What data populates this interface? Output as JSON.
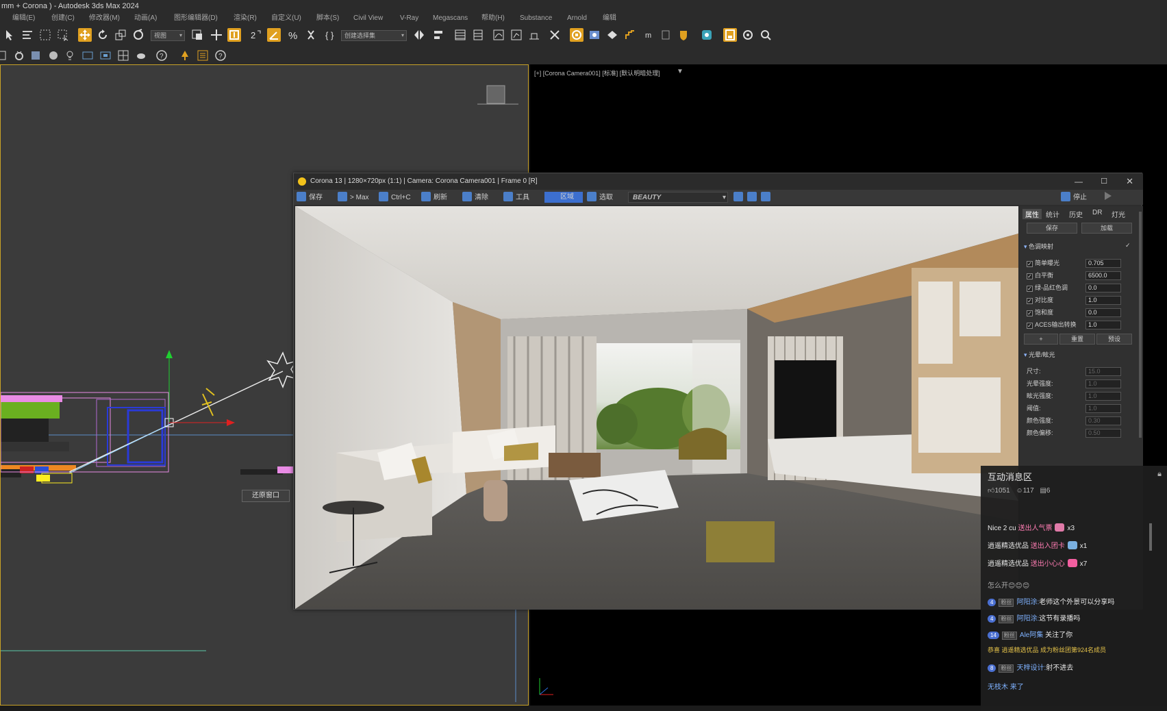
{
  "window": {
    "title": "mm + Corona ) - Autodesk 3ds Max 2024"
  },
  "menu": {
    "items": [
      "编辑(E)",
      "创建(C)",
      "修改器(M)",
      "动画(A)",
      "图形编辑器(D)",
      "渲染(R)",
      "自定义(U)",
      "脚本(S)",
      "Civil View",
      "V-Ray",
      "Megascans",
      "帮助(H)",
      "Substance",
      "Arnold",
      "编辑"
    ]
  },
  "toolbar": {
    "view_dropdown": "视图",
    "selection_set_dropdown": "创建选择集"
  },
  "viewport_right": {
    "label": "[+] [Corona Camera001] [标准] [默认明暗处理]"
  },
  "viewport_left": {
    "restore_button": "还原窗口"
  },
  "vfb": {
    "title": "Corona 13 | 1280×720px (1:1) | Camera: Corona Camera001 | Frame 0 [R]",
    "toolbar": {
      "save": "保存",
      "to_max": "> Max",
      "copy": "Ctrl+C",
      "refresh": "刷新",
      "clear": "清除",
      "tools": "工具",
      "region": "区域",
      "pick": "选取",
      "pass": "BEAUTY",
      "stop": "停止"
    },
    "colors": {
      "accent": "#4b7fc9",
      "active_button": "#3c6fcf"
    },
    "props": {
      "tabs": [
        "属性",
        "统计",
        "历史",
        "DR",
        "灯光"
      ],
      "save_button": "保存",
      "load_button": "加载",
      "section_tone": "色调映射",
      "rows": [
        {
          "label": "简单曝光",
          "value": "0.705"
        },
        {
          "label": "白平衡",
          "value": "6500.0"
        },
        {
          "label": "绿-品红色调",
          "value": "0.0"
        },
        {
          "label": "对比度",
          "value": "1.0"
        },
        {
          "label": "饱和度",
          "value": "0.0"
        },
        {
          "label": "ACES输出转换",
          "value": "1.0"
        }
      ],
      "reset_button": "重置",
      "preset_button": "预设",
      "section_bloom": "光晕/眩光",
      "bloom_rows": [
        {
          "label": "尺寸:",
          "value": "15.0"
        },
        {
          "label": "光晕强度:",
          "value": "1.0"
        },
        {
          "label": "眩光强度:",
          "value": "1.0"
        },
        {
          "label": "阈值:",
          "value": "1.0"
        },
        {
          "label": "颜色强度:",
          "value": "0.30"
        },
        {
          "label": "颜色偏移:",
          "value": "0.50"
        }
      ]
    }
  },
  "chat": {
    "title": "互动消息区",
    "stats": {
      "likes": "1051",
      "viewers": "117",
      "count": "6"
    },
    "gifts": [
      {
        "user": "Nice 2 cu",
        "action": "送出人气票",
        "qty": "x3",
        "color": "#e07aa8"
      },
      {
        "user": "逍遥精选优品",
        "action": "送出入团卡",
        "qty": "x1",
        "color": "#7ab0e0"
      },
      {
        "user": "逍遥精选优品",
        "action": "送出小心心",
        "qty": "x7",
        "color": "#f25fa0"
      }
    ],
    "messages": [
      {
        "text": "怎么开😊😊😊"
      },
      {
        "level": "4",
        "user": "阿阳涂:",
        "text": "老师这个外景可以分享吗"
      },
      {
        "level": "4",
        "user": "阿阳涂:",
        "text": "这节有录播吗"
      },
      {
        "level": "14",
        "user": "Ale阿集",
        "text": "关注了你"
      },
      {
        "text": "恭喜 逍遥精选优品 成为粉丝团第924名成员"
      },
      {
        "level": "8",
        "user": "天梓设计:",
        "text": "射不进去"
      },
      {
        "text": "无枝木 来了"
      }
    ]
  }
}
